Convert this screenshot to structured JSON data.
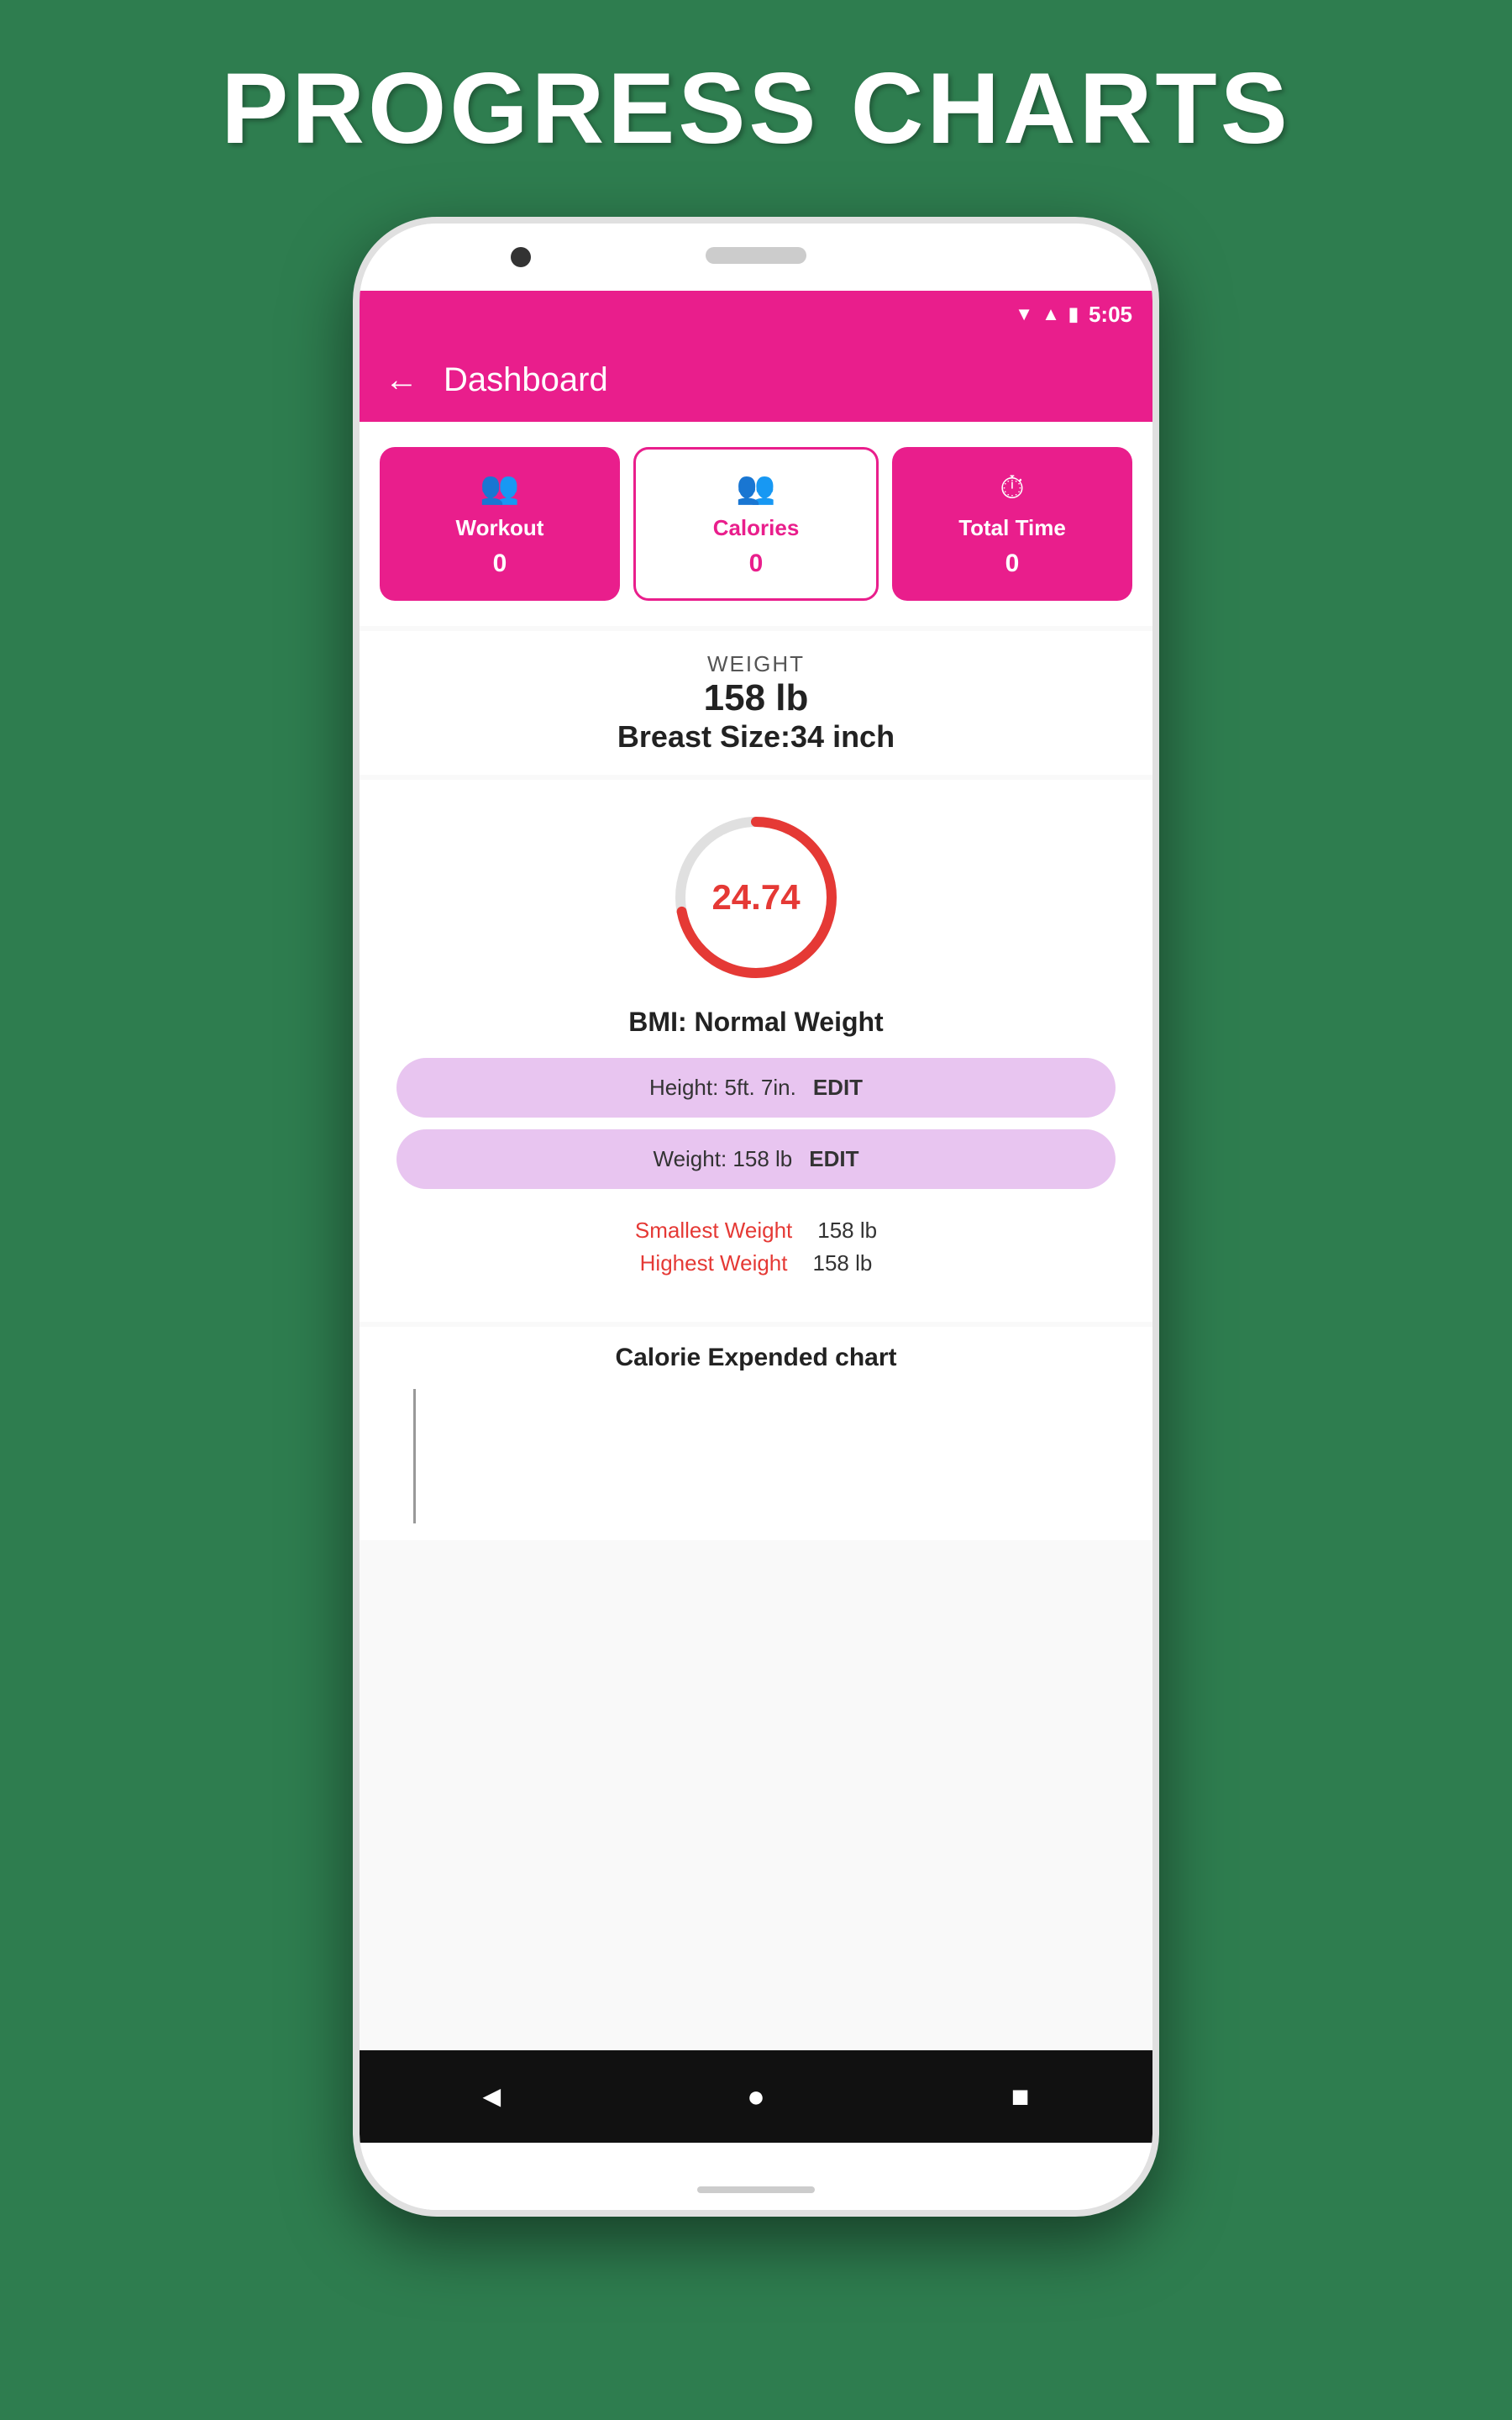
{
  "page": {
    "title": "PROGRESS CHARTS",
    "background_color": "#2e7d4f"
  },
  "status_bar": {
    "time": "5:05",
    "wifi_icon": "▲",
    "signal_icon": "▲",
    "battery_icon": "🔋"
  },
  "app_bar": {
    "back_label": "←",
    "title": "Dashboard"
  },
  "stats": {
    "workout": {
      "label": "Workout",
      "value": "0",
      "icon": "👥"
    },
    "calories": {
      "label": "Calories",
      "value": "0",
      "icon": "👥"
    },
    "total_time": {
      "label": "Total Time",
      "value": "0",
      "icon": "⏱"
    }
  },
  "weight_section": {
    "label": "WEIGHT",
    "value": "158 lb",
    "breast_label": "Breast Size:",
    "breast_value": "34",
    "breast_unit": " inch"
  },
  "bmi": {
    "value": "24.74",
    "label": "BMI: Normal Weight",
    "circle_pct": 72
  },
  "edit_fields": [
    {
      "text": "Height: 5ft. 7in.",
      "button": "EDIT"
    },
    {
      "text": "Weight: 158 lb",
      "button": "EDIT"
    }
  ],
  "weight_stats": [
    {
      "label": "Smallest Weight",
      "value": "158 lb"
    },
    {
      "label": "Highest Weight",
      "value": "158 lb"
    }
  ],
  "calorie_chart": {
    "title": "Calorie Expended chart"
  },
  "bottom_nav": {
    "back": "◄",
    "home": "●",
    "square": "■"
  }
}
